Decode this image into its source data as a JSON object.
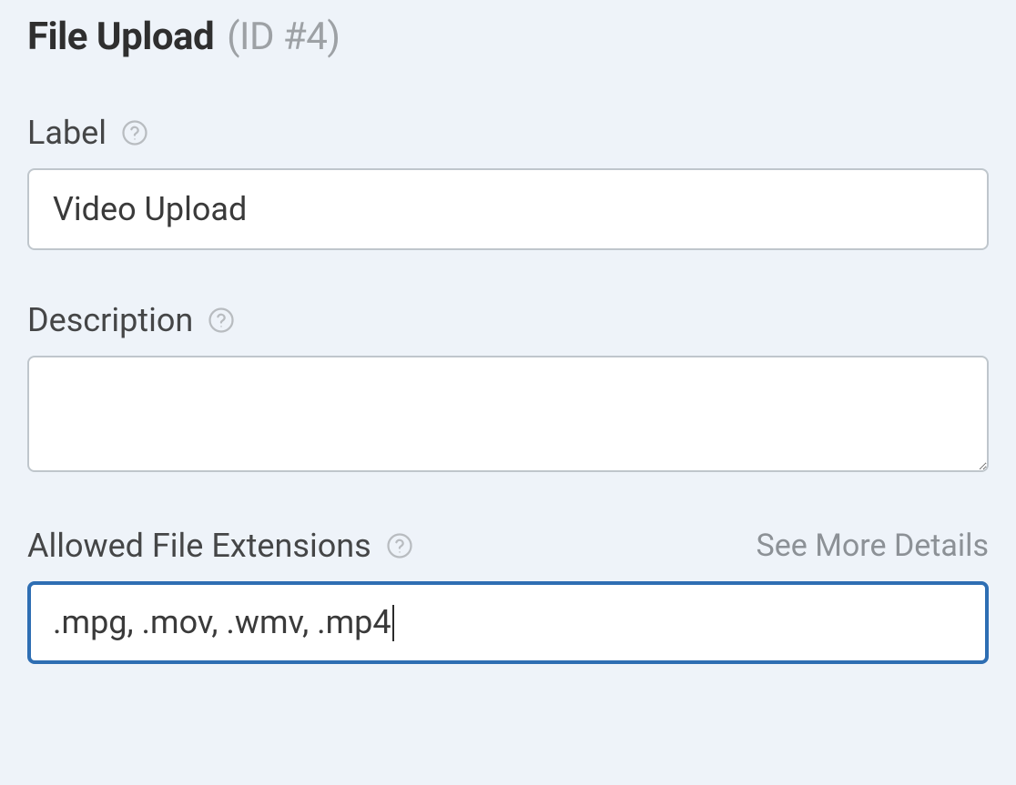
{
  "header": {
    "title": "File Upload",
    "id_text": "(ID #4)"
  },
  "label_field": {
    "label": "Label",
    "value": "Video Upload"
  },
  "description_field": {
    "label": "Description",
    "value": ""
  },
  "extensions_field": {
    "label": "Allowed File Extensions",
    "see_more_link": "See More Details",
    "value": ".mpg, .mov, .wmv, .mp4"
  }
}
